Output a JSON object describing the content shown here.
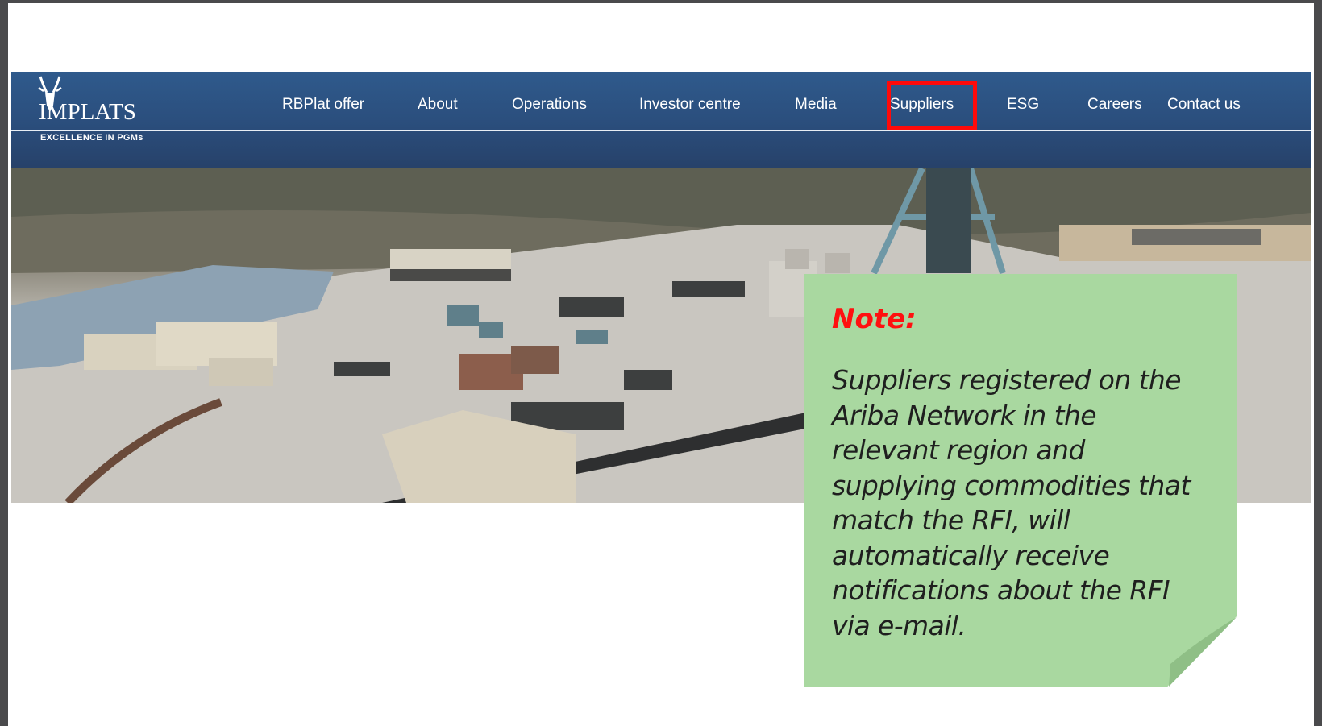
{
  "logo": {
    "name": "IMPLATS",
    "tagline": "EXCELLENCE IN PGMs"
  },
  "nav": {
    "items": [
      {
        "label": "RBPlat offer"
      },
      {
        "label": "About"
      },
      {
        "label": "Operations"
      },
      {
        "label": "Investor centre"
      },
      {
        "label": "Media"
      },
      {
        "label": "Suppliers"
      },
      {
        "label": "ESG"
      },
      {
        "label": "Careers"
      },
      {
        "label": "Contact us"
      }
    ],
    "highlighted_item": "Suppliers"
  },
  "note": {
    "title": "Note:",
    "lines": [
      "Suppliers registered on the",
      "Ariba Network in the",
      "relevant region and",
      "supplying commodities that",
      "match the RFI, will",
      "automatically receive",
      "notifications about the RFI",
      "via e-mail."
    ]
  },
  "colors": {
    "nav_background": "#2b4f7e",
    "highlight": "#ff0a0a",
    "note_background": "#a9d8a0",
    "note_title": "#ff1010"
  }
}
